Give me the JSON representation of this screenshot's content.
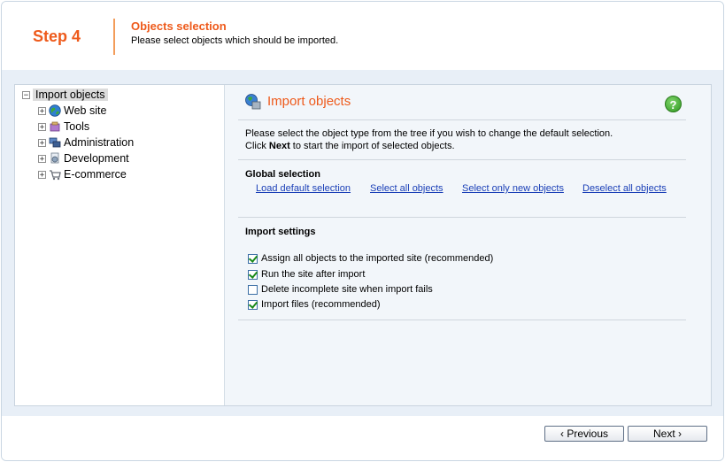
{
  "header": {
    "step": "Step 4",
    "title": "Objects selection",
    "subtitle": "Please select objects which should be imported."
  },
  "tree": {
    "root": "Import objects",
    "items": [
      {
        "label": "Web site",
        "icon": "globe-icon"
      },
      {
        "label": "Tools",
        "icon": "tools-icon"
      },
      {
        "label": "Administration",
        "icon": "administration-icon"
      },
      {
        "label": "Development",
        "icon": "development-icon"
      },
      {
        "label": "E-commerce",
        "icon": "ecommerce-icon"
      }
    ]
  },
  "panel": {
    "title": "Import objects",
    "help": "?",
    "desc_line1": "Please select the object type from the tree if you wish to change the default selection.",
    "desc_line2_pre": "Click ",
    "desc_line2_bold": "Next",
    "desc_line2_post": " to start the import of selected objects.",
    "global_title": "Global selection",
    "links": [
      "Load default selection",
      "Select all objects",
      "Select only new objects",
      "Deselect all objects"
    ],
    "settings_title": "Import settings",
    "settings": [
      {
        "label": "Assign all objects to the imported site (recommended)",
        "checked": true
      },
      {
        "label": "Run the site after import",
        "checked": true
      },
      {
        "label": "Delete incomplete site when import fails",
        "checked": false
      },
      {
        "label": "Import files (recommended)",
        "checked": true
      }
    ]
  },
  "buttons": {
    "previous": "Previous",
    "next": "Next"
  },
  "colors": {
    "accent": "#ee5a1b",
    "band": "#e8eff7",
    "link": "#1a3fb7"
  }
}
